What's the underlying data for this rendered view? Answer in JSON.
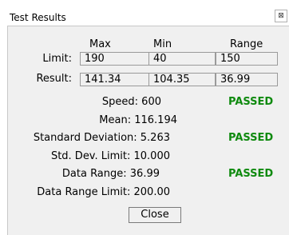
{
  "window": {
    "title": "Test Results",
    "close_glyph": "⊠"
  },
  "columns": {
    "max": "Max",
    "min": "Min",
    "range": "Range"
  },
  "rows": {
    "limit": {
      "label": "Limit:",
      "max": "190",
      "min": "40",
      "range": "150"
    },
    "result": {
      "label": "Result:",
      "max": "141.34",
      "min": "104.35",
      "range": "36.99"
    }
  },
  "stats": {
    "speed": "Speed: 600",
    "mean": "Mean: 116.194",
    "std_dev": "Standard Deviation: 5.263",
    "std_dev_limit": "Std. Dev. Limit: 10.000",
    "data_range": "Data Range: 36.99",
    "data_range_limit": "Data Range Limit: 200.00"
  },
  "status": {
    "speed": "PASSED",
    "std_dev": "PASSED",
    "data_range": "PASSED"
  },
  "buttons": {
    "close": "Close"
  },
  "colors": {
    "passed": "#0f8a0f",
    "panel": "#f0f0f0"
  }
}
